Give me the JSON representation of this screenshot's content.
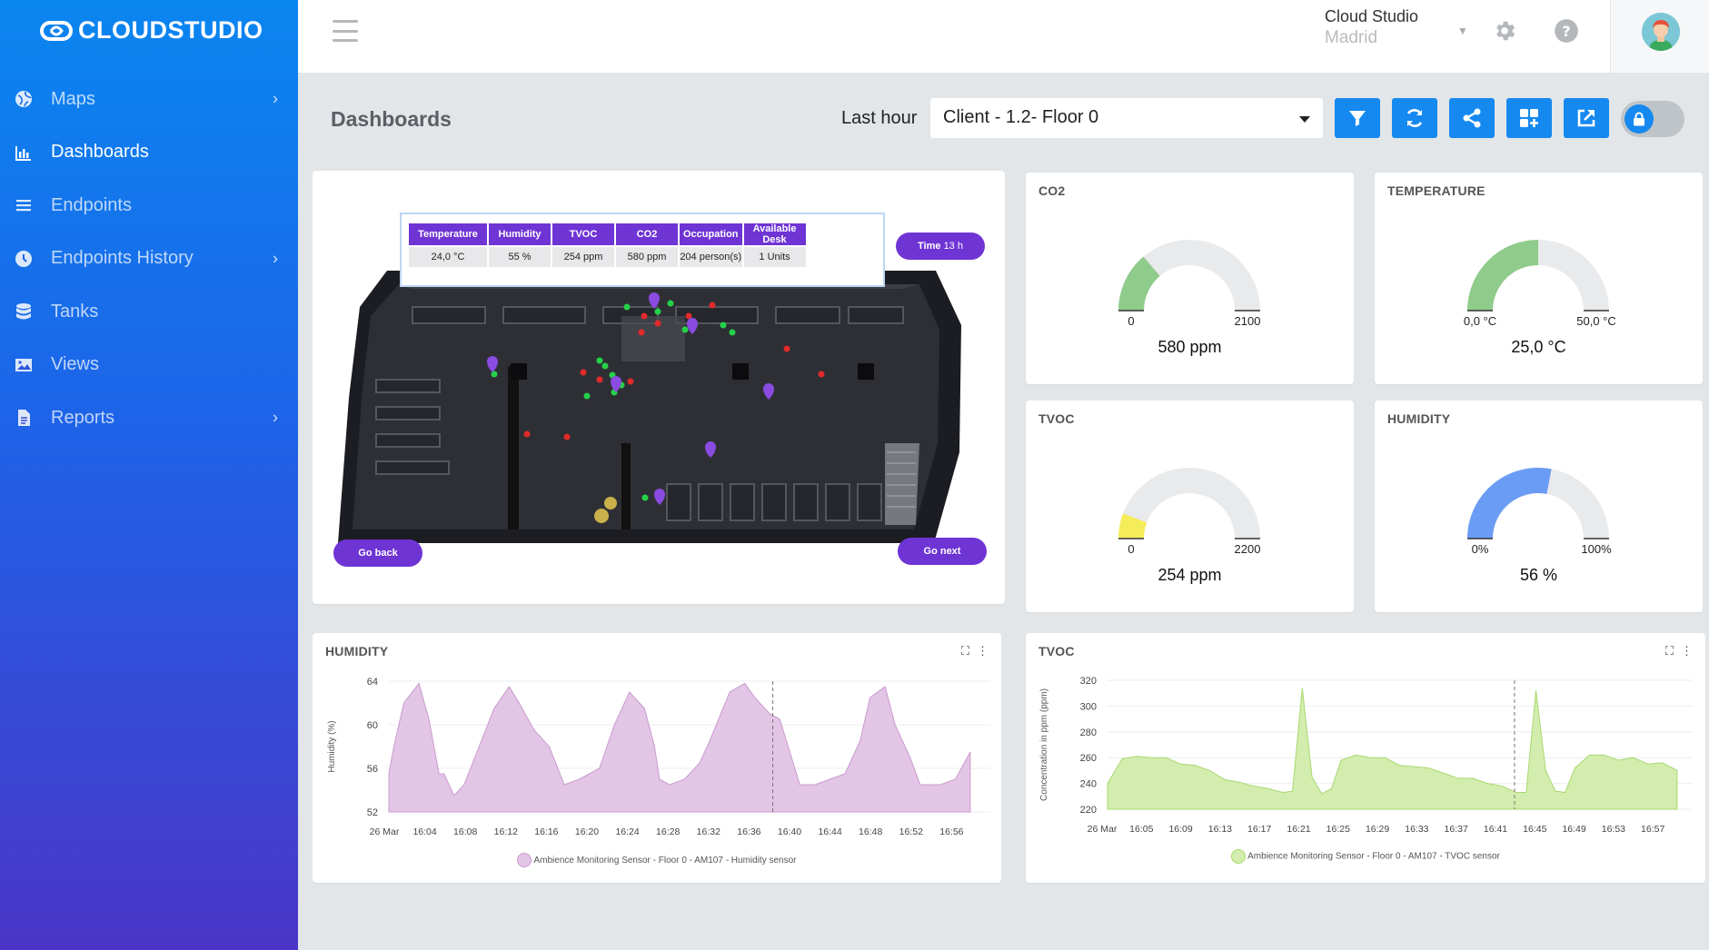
{
  "brand": {
    "name": "CLOUDSTUDIO",
    "accent": "#1589f0",
    "purple": "#6f34d4"
  },
  "sidebar": {
    "items": [
      {
        "label": "Maps",
        "icon": "globe-icon",
        "has_submenu": true
      },
      {
        "label": "Dashboards",
        "icon": "bar-chart-icon",
        "has_submenu": false,
        "active": true
      },
      {
        "label": "Endpoints",
        "icon": "list-icon",
        "has_submenu": false
      },
      {
        "label": "Endpoints History",
        "icon": "clock-icon",
        "has_submenu": true
      },
      {
        "label": "Tanks",
        "icon": "database-icon",
        "has_submenu": false
      },
      {
        "label": "Views",
        "icon": "image-icon",
        "has_submenu": false
      },
      {
        "label": "Reports",
        "icon": "file-icon",
        "has_submenu": true
      }
    ]
  },
  "topbar": {
    "account_name": "Cloud Studio",
    "account_city": "Madrid"
  },
  "header": {
    "title": "Dashboards",
    "range_label": "Last hour",
    "selected_dashboard": "Client - 1.2- Floor 0",
    "toolbar_icons": [
      "filter-icon",
      "refresh-icon",
      "share-icon",
      "add-widget-icon",
      "external-link-icon",
      "lock-icon"
    ]
  },
  "floorplan": {
    "headers": [
      "Temperature",
      "Humidity",
      "TVOC",
      "CO2",
      "Occupation",
      "Available Desk"
    ],
    "values": [
      "24,0 °C",
      "55 %",
      "254 ppm",
      "580 ppm",
      "204 person(s)",
      "1 Units"
    ],
    "time_label": "Time",
    "time_value": "13 h",
    "go_back": "Go back",
    "go_next": "Go next"
  },
  "gauges": {
    "co2": {
      "title": "CO2",
      "min": "0",
      "max": "2100",
      "value": "580 ppm",
      "fraction": 0.276,
      "color": "#8fcb8b"
    },
    "temperature": {
      "title": "TEMPERATURE",
      "min": "0,0 °C",
      "max": "50,0 °C",
      "value": "25,0 °C",
      "fraction": 0.5,
      "color": "#8fcb8b"
    },
    "tvoc": {
      "title": "TVOC",
      "min": "0",
      "max": "2200",
      "value": "254 ppm",
      "fraction": 0.115,
      "color": "#f5ec5a"
    },
    "humidity": {
      "title": "HUMIDITY",
      "min": "0%",
      "max": "100%",
      "value": "56 %",
      "fraction": 0.56,
      "color": "#6b9cf5"
    }
  },
  "chart_data": [
    {
      "type": "area",
      "title": "HUMIDITY",
      "ylabel": "Humidity (%)",
      "xlabel": "",
      "x_ticks": [
        "26 Mar",
        "16:04",
        "16:08",
        "16:12",
        "16:16",
        "16:20",
        "16:24",
        "16:28",
        "16:32",
        "16:36",
        "16:40",
        "16:44",
        "16:48",
        "16:52",
        "16:56"
      ],
      "y_ticks": [
        52,
        56,
        60,
        64
      ],
      "ylim": [
        52,
        64
      ],
      "color": "#e3c5e6",
      "stroke": "#c99ccf",
      "series": [
        {
          "name": "Ambience Monitoring Sensor - Floor 0 - AM107 - Humidity sensor",
          "x_minutes": [
            0,
            0.5,
            1.5,
            3,
            4,
            5,
            5.5,
            6.5,
            7.5,
            9,
            10.5,
            12,
            13,
            14.5,
            16,
            17.5,
            19,
            20,
            21,
            22.5,
            24,
            25.5,
            26.5,
            27,
            28,
            29.5,
            31,
            32,
            34,
            35.5,
            36.5,
            38,
            39,
            40,
            41,
            42.5,
            44,
            45.5,
            47,
            48,
            49.5,
            50.5,
            52,
            53,
            55,
            56.5,
            58
          ],
          "values": [
            55.5,
            58,
            62,
            63.8,
            60.5,
            55.5,
            55.5,
            53.5,
            54.5,
            58,
            61.5,
            63.5,
            62,
            59.5,
            58,
            54.5,
            55,
            55.5,
            56,
            60,
            63,
            61.5,
            58,
            55,
            54.5,
            55,
            56.5,
            58.5,
            63,
            63.8,
            62.5,
            61,
            60.5,
            57.5,
            54.5,
            54.5,
            55,
            55.5,
            58.5,
            62.5,
            63.5,
            60,
            57,
            54.5,
            54.5,
            55,
            57.5
          ]
        }
      ]
    },
    {
      "type": "area",
      "title": "TVOC",
      "ylabel": "Concentration in ppm (ppm)",
      "xlabel": "",
      "x_ticks": [
        "26 Mar",
        "16:05",
        "16:09",
        "16:13",
        "16:17",
        "16:21",
        "16:25",
        "16:29",
        "16:33",
        "16:37",
        "16:41",
        "16:45",
        "16:49",
        "16:53",
        "16:57"
      ],
      "y_ticks": [
        220,
        240,
        260,
        280,
        300,
        320
      ],
      "ylim": [
        220,
        320
      ],
      "color": "#d3edae",
      "stroke": "#a8d86f",
      "series": [
        {
          "name": "Ambience Monitoring Sensor - Floor 0 - AM107 - TVOC sensor",
          "x_minutes": [
            0,
            1.5,
            3,
            4.5,
            6,
            7.5,
            9,
            10.5,
            12,
            13.5,
            15,
            16.5,
            18,
            19,
            20,
            21,
            22,
            23,
            24,
            25.5,
            27,
            28.5,
            30,
            31.5,
            33,
            34.5,
            36,
            37.5,
            39,
            40.5,
            42,
            43,
            44,
            45,
            46,
            47,
            48,
            49.5,
            51,
            52.5,
            54,
            55.5,
            57,
            58.5
          ],
          "values": [
            240,
            259,
            261,
            260,
            260,
            255,
            254,
            250,
            243,
            241,
            238,
            236,
            233,
            234,
            314,
            245,
            232,
            236,
            258,
            262,
            260,
            260,
            254,
            253,
            252,
            248,
            244,
            244,
            240,
            238,
            233,
            233,
            312,
            250,
            234,
            233,
            252,
            262,
            262,
            258,
            260,
            255,
            256,
            250
          ]
        }
      ]
    }
  ]
}
